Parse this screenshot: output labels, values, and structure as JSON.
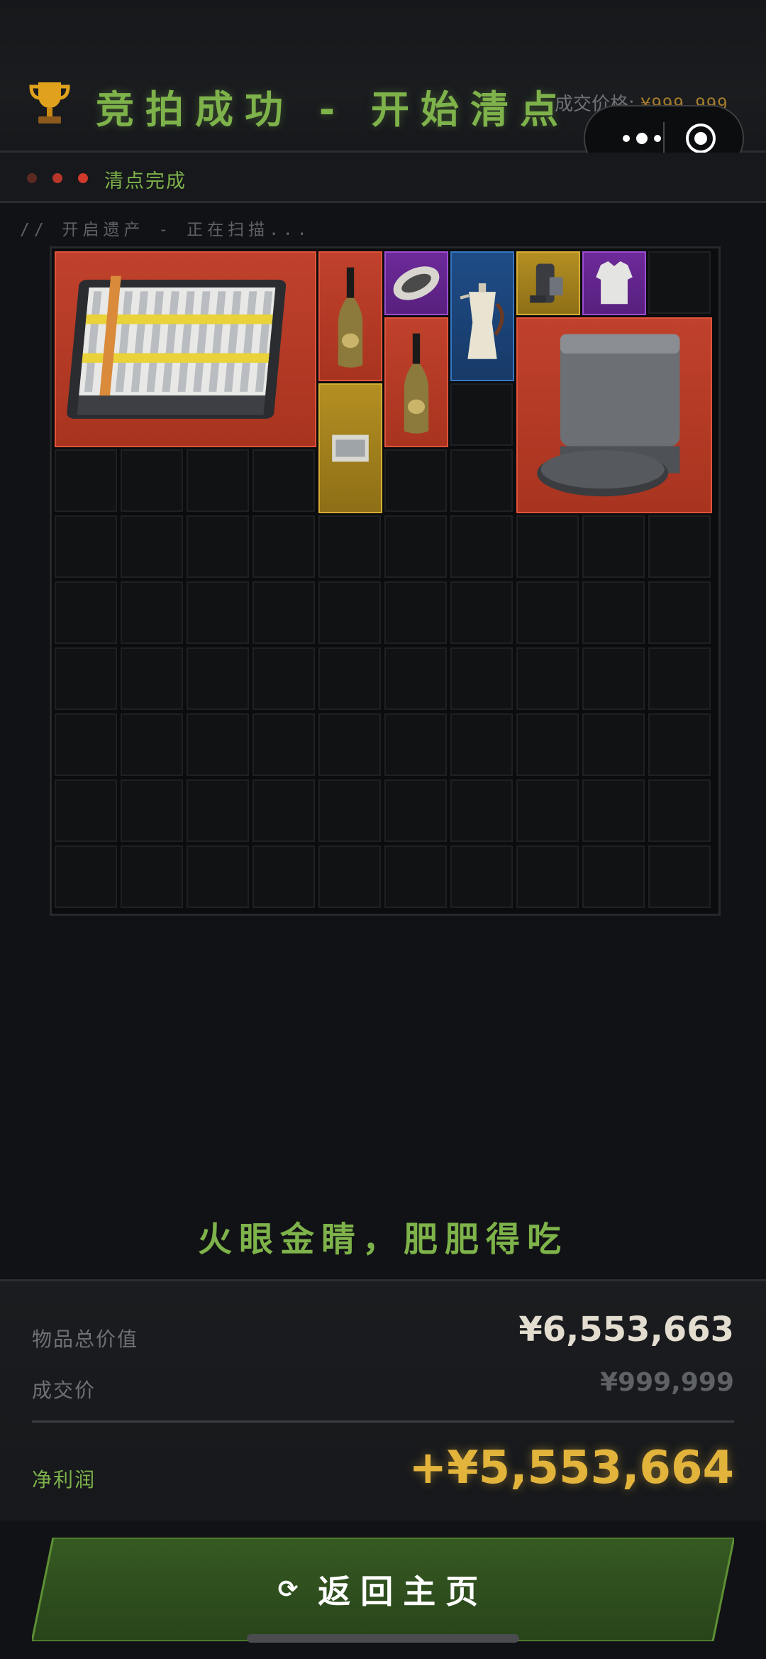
{
  "header": {
    "title": "竞拍成功 - 开始清点",
    "deal_price_label": "成交价格: ",
    "deal_price_value": "¥999,999",
    "trophy_icon": "trophy-icon"
  },
  "capsule": {
    "more_icon": "more-dots-icon",
    "close_icon": "target-close-icon"
  },
  "status": {
    "text": "清点完成",
    "dot_colors": [
      "#5a2a22",
      "#b8352a",
      "#d0392b"
    ]
  },
  "scan_text": "//  开启遗产 - 正在扫描...",
  "inventory": {
    "columns": 10,
    "rows": 10,
    "items": [
      {
        "name": "battery-pack-item",
        "rarity": "red",
        "col": 0,
        "row": 0,
        "w": 4,
        "h": 3
      },
      {
        "name": "champagne-bottle-item",
        "rarity": "red",
        "col": 4,
        "row": 0,
        "w": 1,
        "h": 2
      },
      {
        "name": "gold-card-item",
        "rarity": "gold",
        "col": 4,
        "row": 2,
        "w": 1,
        "h": 2
      },
      {
        "name": "rugby-ball-item",
        "rarity": "purple",
        "col": 5,
        "row": 0,
        "w": 1,
        "h": 1
      },
      {
        "name": "champagne-bottle-item-2",
        "rarity": "red",
        "col": 5,
        "row": 1,
        "w": 1,
        "h": 2
      },
      {
        "name": "coffee-pot-item",
        "rarity": "blue",
        "col": 6,
        "row": 0,
        "w": 1,
        "h": 2
      },
      {
        "name": "drone-gadget-item",
        "rarity": "gold",
        "col": 7,
        "row": 0,
        "w": 1,
        "h": 1
      },
      {
        "name": "body-armor-item",
        "rarity": "purple",
        "col": 8,
        "row": 0,
        "w": 1,
        "h": 1
      },
      {
        "name": "robot-vacuum-station-item",
        "rarity": "red",
        "col": 7,
        "row": 1,
        "w": 3,
        "h": 3
      }
    ]
  },
  "slogan": "火眼金睛，肥肥得吃",
  "summary": {
    "total_label": "物品总价值",
    "total_value": "¥6,553,663",
    "price_label": "成交价",
    "price_value": "¥999,999",
    "profit_label": "净利润",
    "profit_value": "+¥5,553,664"
  },
  "home_button": {
    "icon": "refresh-icon",
    "icon_glyph": "⟳",
    "label": "返回主页"
  },
  "colors": {
    "accent_green": "#7eb24a",
    "gold": "#e2b43c",
    "red_rarity": "#c0412c",
    "purple_rarity": "#6d2a9a",
    "blue_rarity": "#1f4c86",
    "gold_rarity": "#b48f22"
  }
}
